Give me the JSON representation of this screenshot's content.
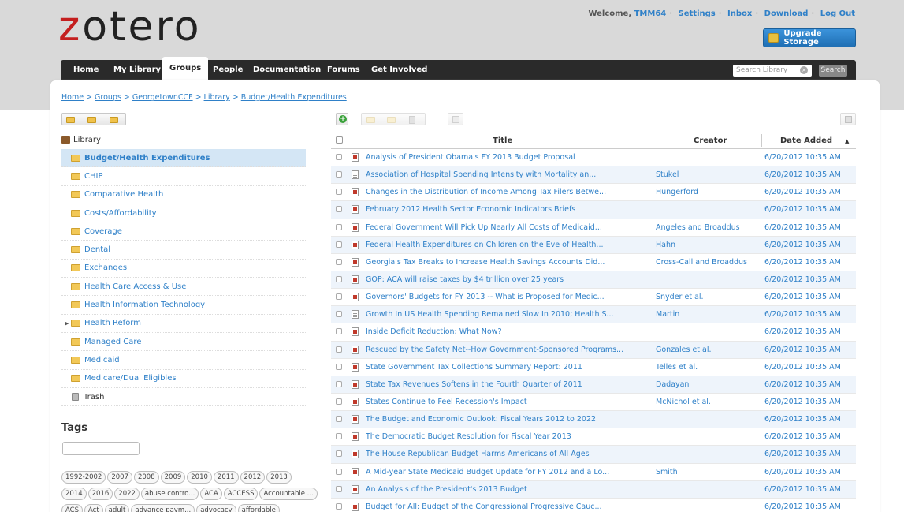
{
  "logo": {
    "z": "z",
    "rest": "otero"
  },
  "userbar": {
    "welcome": "Welcome,",
    "user": "TMM64",
    "links": [
      "Settings",
      "Inbox",
      "Download",
      "Log Out"
    ]
  },
  "upgrade": {
    "label": "Upgrade Storage"
  },
  "nav": {
    "tabs": [
      "Home",
      "My Library",
      "Groups",
      "People",
      "Documentation",
      "Forums",
      "Get Involved"
    ],
    "active": "Groups",
    "search_placeholder": "Search Library",
    "search_button": "Search"
  },
  "breadcrumb": [
    "Home",
    "Groups",
    "GeorgetownCCF",
    "Library",
    "Budget/Health Expenditures"
  ],
  "library": {
    "root": "Library",
    "collections": [
      {
        "label": "Budget/Health Expenditures",
        "selected": true
      },
      {
        "label": "CHIP"
      },
      {
        "label": "Comparative Health"
      },
      {
        "label": "Costs/Affordability"
      },
      {
        "label": "Coverage"
      },
      {
        "label": "Dental"
      },
      {
        "label": "Exchanges"
      },
      {
        "label": "Health Care Access & Use"
      },
      {
        "label": "Health Information Technology"
      },
      {
        "label": "Health Reform",
        "expandable": true
      },
      {
        "label": "Managed Care"
      },
      {
        "label": "Medicaid"
      },
      {
        "label": "Medicare/Dual Eligibles"
      },
      {
        "label": "Trash",
        "trash": true
      }
    ]
  },
  "tags": {
    "heading": "Tags",
    "rows": [
      [
        "1992-2002",
        "2007",
        "2008",
        "2009",
        "2010",
        "2011",
        "2012",
        "2013"
      ],
      [
        "2014",
        "2016",
        "2022",
        "abuse contro...",
        "ACA",
        "ACCESS",
        "Accountable ..."
      ],
      [
        "ACS",
        "Act",
        "adult",
        "advance paym...",
        "advocacy",
        "affordable"
      ]
    ]
  },
  "table": {
    "headers": {
      "title": "Title",
      "creator": "Creator",
      "date": "Date Added"
    },
    "rows": [
      {
        "title": "Analysis of President Obama's FY 2013 Budget Proposal",
        "creator": "",
        "date": "6/20/2012 10:35 AM",
        "icon": "journal"
      },
      {
        "title": "Association of Hospital Spending Intensity with Mortality an...",
        "creator": "Stukel",
        "date": "6/20/2012 10:35 AM",
        "icon": "doc"
      },
      {
        "title": "Changes in the Distribution of Income Among Tax Filers Betwe...",
        "creator": "Hungerford",
        "date": "6/20/2012 10:35 AM",
        "icon": "journal"
      },
      {
        "title": "February 2012 Health Sector Economic Indicators Briefs",
        "creator": "",
        "date": "6/20/2012 10:35 AM",
        "icon": "journal"
      },
      {
        "title": "Federal Government Will Pick Up Nearly All Costs of Medicaid...",
        "creator": "Angeles and Broaddus",
        "date": "6/20/2012 10:35 AM",
        "icon": "journal"
      },
      {
        "title": "Federal Health Expenditures on Children on the Eve of Health...",
        "creator": "Hahn",
        "date": "6/20/2012 10:35 AM",
        "icon": "journal"
      },
      {
        "title": "Georgia's Tax Breaks to Increase Health Savings Accounts Did...",
        "creator": "Cross-Call and Broaddus",
        "date": "6/20/2012 10:35 AM",
        "icon": "journal"
      },
      {
        "title": "GOP: ACA will raise taxes by $4 trillion over 25 years",
        "creator": "",
        "date": "6/20/2012 10:35 AM",
        "icon": "journal"
      },
      {
        "title": "Governors' Budgets for FY 2013 -- What is Proposed for Medic...",
        "creator": "Snyder et al.",
        "date": "6/20/2012 10:35 AM",
        "icon": "journal"
      },
      {
        "title": "Growth In US Health Spending Remained Slow In 2010; Health S...",
        "creator": "Martin",
        "date": "6/20/2012 10:35 AM",
        "icon": "doc"
      },
      {
        "title": "Inside Deficit Reduction: What Now?",
        "creator": "",
        "date": "6/20/2012 10:35 AM",
        "icon": "journal"
      },
      {
        "title": "Rescued by the Safety Net--How Government-Sponsored Programs...",
        "creator": "Gonzales et al.",
        "date": "6/20/2012 10:35 AM",
        "icon": "journal"
      },
      {
        "title": "State Government Tax Collections Summary Report: 2011",
        "creator": "Telles et al.",
        "date": "6/20/2012 10:35 AM",
        "icon": "journal"
      },
      {
        "title": "State Tax Revenues Softens in the Fourth Quarter of 2011",
        "creator": "Dadayan",
        "date": "6/20/2012 10:35 AM",
        "icon": "journal"
      },
      {
        "title": "States Continue to Feel Recession's Impact",
        "creator": "McNichol et al.",
        "date": "6/20/2012 10:35 AM",
        "icon": "journal"
      },
      {
        "title": "The Budget and Economic Outlook: Fiscal Years 2012 to 2022",
        "creator": "",
        "date": "6/20/2012 10:35 AM",
        "icon": "journal"
      },
      {
        "title": "The Democratic Budget Resolution for Fiscal Year 2013",
        "creator": "",
        "date": "6/20/2012 10:35 AM",
        "icon": "journal"
      },
      {
        "title": "The House Republican Budget Harms Americans of All Ages",
        "creator": "",
        "date": "6/20/2012 10:35 AM",
        "icon": "journal"
      },
      {
        "title": "A Mid-year State Medicaid Budget Update for FY 2012 and a Lo...",
        "creator": "Smith",
        "date": "6/20/2012 10:35 AM",
        "icon": "journal"
      },
      {
        "title": "An Analysis of the President's 2013 Budget",
        "creator": "",
        "date": "6/20/2012 10:35 AM",
        "icon": "journal"
      },
      {
        "title": "Budget for All: Budget of the Congressional Progressive Cauc...",
        "creator": "",
        "date": "6/20/2012 10:35 AM",
        "icon": "journal"
      }
    ]
  }
}
